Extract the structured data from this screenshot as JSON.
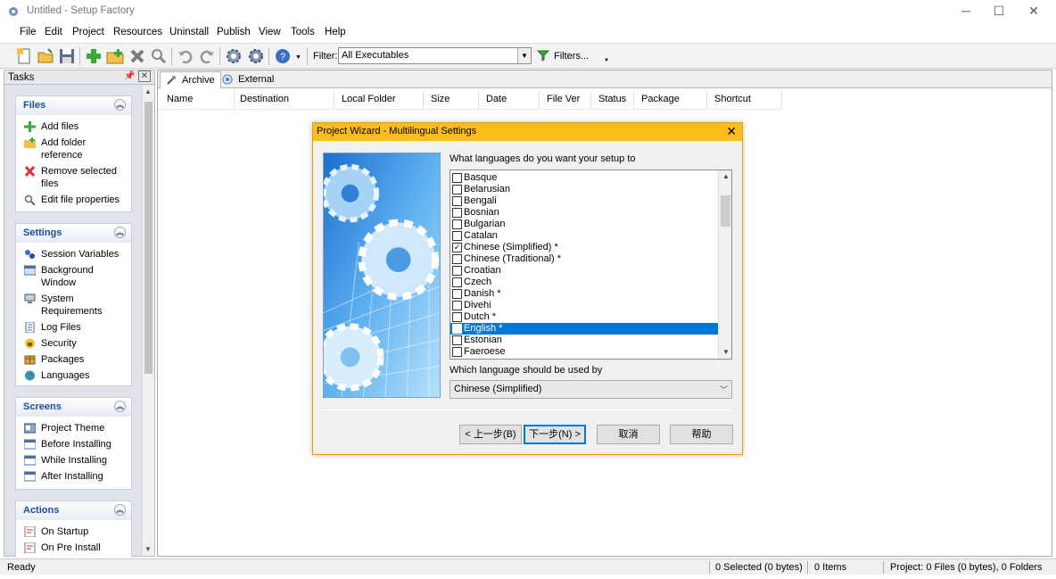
{
  "window": {
    "title": "Untitled - Setup Factory",
    "minimize": "─",
    "maximize": "☐",
    "close": "✕"
  },
  "menu": [
    "File",
    "Edit",
    "Project",
    "Resources",
    "Uninstall",
    "Publish",
    "View",
    "Tools",
    "Help"
  ],
  "toolbar": {
    "filter_label": "Filter:",
    "filter_value": "All Executables",
    "filters_button": "Filters..."
  },
  "tasks": {
    "title": "Tasks",
    "groups": [
      {
        "title": "Files",
        "items": [
          "Add files",
          "Add folder reference",
          "Remove selected files",
          "Edit file properties"
        ]
      },
      {
        "title": "Settings",
        "items": [
          "Session Variables",
          "Background Window",
          "System Requirements",
          "Log Files",
          "Security",
          "Packages",
          "Languages"
        ]
      },
      {
        "title": "Screens",
        "items": [
          "Project Theme",
          "Before Installing",
          "While Installing",
          "After Installing"
        ]
      },
      {
        "title": "Actions",
        "items": [
          "On Startup",
          "On Pre Install"
        ]
      }
    ]
  },
  "main": {
    "tabs": [
      "Archive",
      "External"
    ],
    "columns": [
      "Name",
      "Destination",
      "Local Folder",
      "Size",
      "Date",
      "File Ver",
      "Status",
      "Package",
      "Shortcut"
    ]
  },
  "dialog": {
    "title": "Project Wizard - Multilingual Settings",
    "question": "What languages do you want your setup to",
    "languages": [
      {
        "name": "Basque",
        "checked": false
      },
      {
        "name": "Belarusian",
        "checked": false
      },
      {
        "name": "Bengali",
        "checked": false
      },
      {
        "name": "Bosnian",
        "checked": false
      },
      {
        "name": "Bulgarian",
        "checked": false
      },
      {
        "name": "Catalan",
        "checked": false
      },
      {
        "name": "Chinese (Simplified) *",
        "checked": true
      },
      {
        "name": "Chinese (Traditional) *",
        "checked": false
      },
      {
        "name": "Croatian",
        "checked": false
      },
      {
        "name": "Czech",
        "checked": false
      },
      {
        "name": "Danish *",
        "checked": false
      },
      {
        "name": "Divehi",
        "checked": false
      },
      {
        "name": "Dutch *",
        "checked": false
      },
      {
        "name": "English *",
        "checked": false,
        "selected": true
      },
      {
        "name": "Estonian",
        "checked": false
      },
      {
        "name": "Faeroese",
        "checked": false
      }
    ],
    "which_label": "Which language should be used by",
    "default_language": "Chinese (Simplified)",
    "buttons": {
      "back": "< 上一步(B)",
      "next": "下一步(N) >",
      "cancel": "取消",
      "help": "帮助"
    }
  },
  "status": {
    "ready": "Ready",
    "selected": "0 Selected (0 bytes)",
    "items": "0 Items",
    "project": "Project: 0 Files (0 bytes), 0 Folders"
  },
  "colors": {
    "dialog_title": "#fbbd19",
    "selection": "#0078d7",
    "group_title": "#1d4aa0"
  }
}
